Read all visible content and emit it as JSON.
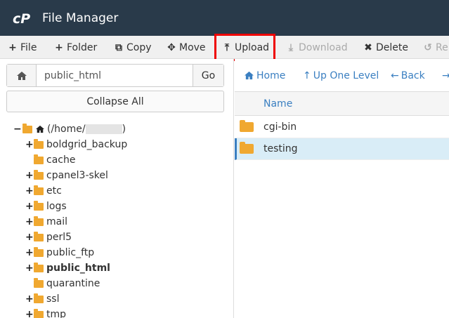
{
  "app": {
    "title": "File Manager"
  },
  "toolbar": {
    "file": "File",
    "folder": "Folder",
    "copy": "Copy",
    "move": "Move",
    "upload": "Upload",
    "download": "Download",
    "delete": "Delete",
    "restore_partial": "Re"
  },
  "sidebar": {
    "path_value": "public_html",
    "go": "Go",
    "collapse_all": "Collapse All",
    "root_label_prefix": "(/home/",
    "root_label_suffix": ")",
    "tree": [
      {
        "label": "boldgrid_backup",
        "expandable": true,
        "bold": false
      },
      {
        "label": "cache",
        "expandable": false,
        "bold": false
      },
      {
        "label": "cpanel3-skel",
        "expandable": true,
        "bold": false
      },
      {
        "label": "etc",
        "expandable": true,
        "bold": false
      },
      {
        "label": "logs",
        "expandable": true,
        "bold": false
      },
      {
        "label": "mail",
        "expandable": true,
        "bold": false
      },
      {
        "label": "perl5",
        "expandable": true,
        "bold": false
      },
      {
        "label": "public_ftp",
        "expandable": true,
        "bold": false
      },
      {
        "label": "public_html",
        "expandable": true,
        "bold": true
      },
      {
        "label": "quarantine",
        "expandable": false,
        "bold": false
      },
      {
        "label": "ssl",
        "expandable": true,
        "bold": false
      },
      {
        "label": "tmp",
        "expandable": true,
        "bold": false
      }
    ]
  },
  "main": {
    "nav": {
      "home": "Home",
      "up_one_level": "Up One Level",
      "back": "Back"
    },
    "columns": {
      "name": "Name"
    },
    "files": [
      {
        "name": "cgi-bin",
        "selected": false
      },
      {
        "name": "testing",
        "selected": true
      }
    ]
  },
  "colors": {
    "header_bg": "#293a4a",
    "link": "#3a7fc1",
    "folder": "#f0a830",
    "highlight": "#ee0000",
    "selected_row": "#d9edf7"
  }
}
